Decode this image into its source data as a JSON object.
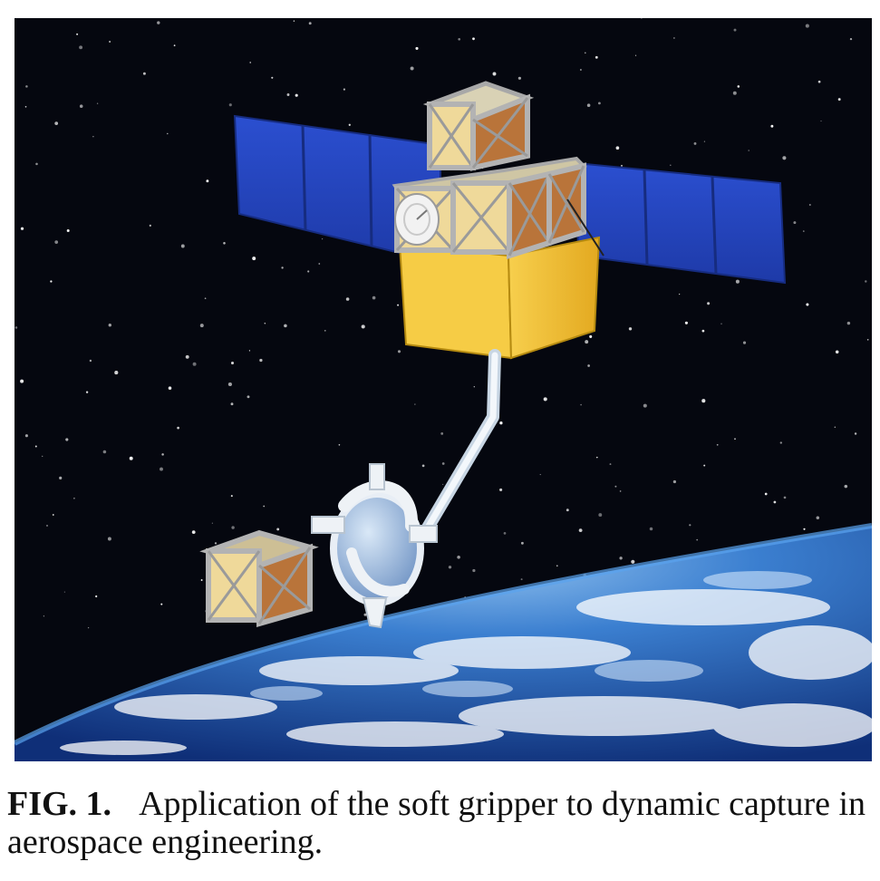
{
  "figure": {
    "label": "FIG. 1.",
    "caption": "Application of the soft gripper to dynamic capture in aerospace engineering.",
    "illustration": {
      "background_color": "#05070f",
      "solar_panel_color": "#2546c4",
      "bus_color": "#f2c23a",
      "module_face_color": "#efd99a",
      "module_side_color": "#b9743a",
      "frame_color": "#b8b8b8",
      "earth_color": "#2f6fc4",
      "arm_color": "#e6eef6",
      "icons": [
        "satellite",
        "solar-panel",
        "payload-module",
        "satellite-dish",
        "robotic-arm",
        "soft-gripper",
        "target-cube",
        "earth"
      ]
    }
  }
}
